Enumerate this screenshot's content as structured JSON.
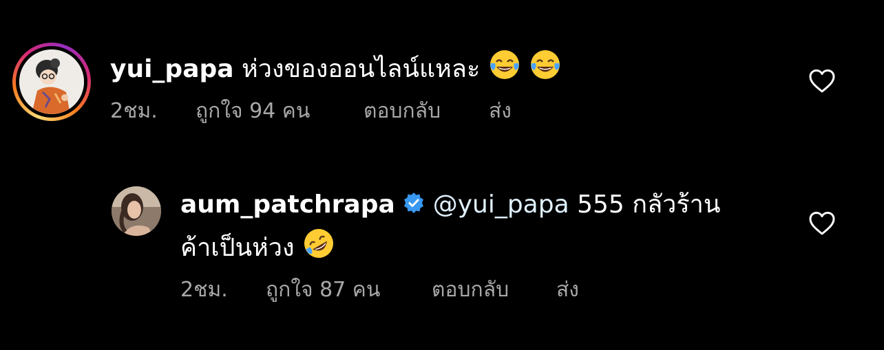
{
  "comments": [
    {
      "username": "yui_papa",
      "text": "ห่วงของออนไลน์แหละ",
      "emojis": [
        "face-with-tears-of-joy",
        "face-with-tears-of-joy"
      ],
      "time": "2ชม.",
      "likes": "ถูกใจ 94 คน",
      "reply": "ตอบกลับ",
      "send": "ส่ง",
      "avatar_ring": true
    },
    {
      "username": "aum_patchrapa",
      "verified": true,
      "mention": "@yui_papa",
      "text_line1": "555 กลัวร้าน",
      "text_line2": "ค้าเป็นห่วง",
      "emoji": "rolling-on-the-floor-laughing",
      "time": "2ชม.",
      "likes": "ถูกใจ 87 คน",
      "reply": "ตอบกลับ",
      "send": "ส่ง"
    }
  ],
  "colors": {
    "background": "#000000",
    "text": "#ffffff",
    "meta": "#a8a8a8",
    "mention": "#e0f1ff",
    "verified": "#3897f0"
  }
}
